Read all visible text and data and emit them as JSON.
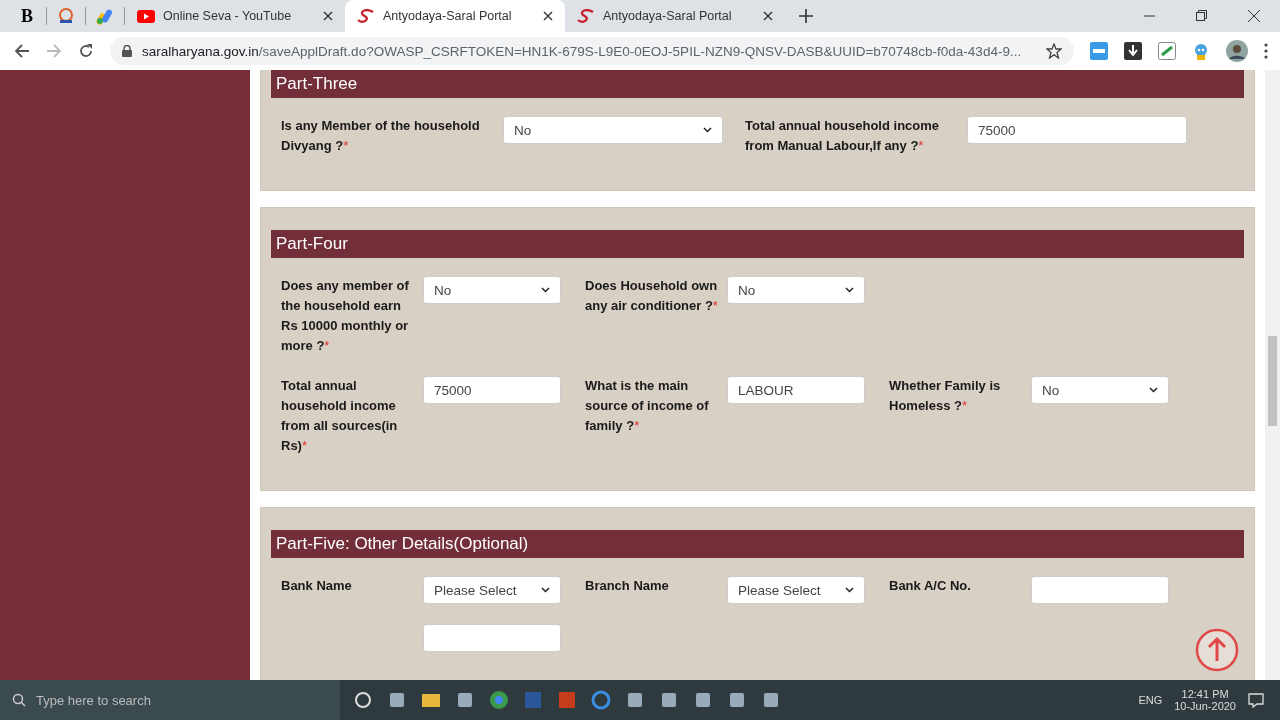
{
  "browser": {
    "pinned_tabs": [
      {
        "kind": "letter",
        "label": "B"
      },
      {
        "kind": "emblem"
      },
      {
        "kind": "ads"
      }
    ],
    "tabs": [
      {
        "title": "Online Seva - YouTube",
        "kind": "youtube",
        "selected": false
      },
      {
        "title": "Antyodaya-Saral Portal",
        "kind": "saral",
        "selected": true
      },
      {
        "title": "Antyodaya-Saral Portal",
        "kind": "saral",
        "selected": false
      }
    ],
    "address": {
      "host": "saralharyana.gov.in",
      "path": "/saveApplDraft.do?OWASP_CSRFTOKEN=HN1K-679S-L9E0-0EOJ-5PIL-NZN9-QNSV-DASB&UUID=b70748cb-f0da-43d4-9..."
    }
  },
  "sections": [
    {
      "title": "Part-Three",
      "kind": "wide",
      "rows": [
        [
          {
            "label": "Is any Member of the household Divyang ?",
            "required_mark": "*",
            "control": {
              "kind": "select",
              "value": "No"
            }
          },
          {
            "label": "Total annual household income from Manual Labour,If any ?",
            "required_mark": "*",
            "control": {
              "kind": "input",
              "value": "75000"
            }
          }
        ]
      ]
    },
    {
      "title": "Part-Four",
      "kind": "narrow",
      "rows": [
        [
          {
            "label": "Does any member of the household earn Rs 10000 monthly or more ?",
            "required_mark": "*",
            "control": {
              "kind": "select",
              "value": "No"
            }
          },
          {
            "label": "Does Household own any air conditioner ?",
            "required_mark": "*",
            "control": {
              "kind": "select",
              "value": "No"
            }
          }
        ],
        [
          {
            "label": "Total annual household income from all sources(in Rs)",
            "required_mark": "*",
            "control": {
              "kind": "input",
              "value": "75000"
            }
          },
          {
            "label": "What is the main source of income of family ?",
            "required_mark": "*",
            "control": {
              "kind": "input",
              "value": "LABOUR"
            }
          },
          {
            "label": "Whether Family is Homeless ?",
            "required_mark": "*",
            "control": {
              "kind": "select",
              "value": "No"
            }
          }
        ]
      ]
    },
    {
      "title": "Part-Five: Other Details(Optional)",
      "kind": "narrow",
      "rows": [
        [
          {
            "label": "Bank Name",
            "control": {
              "kind": "select",
              "value": "Please Select"
            }
          },
          {
            "label": "Branch Name",
            "control": {
              "kind": "select",
              "value": "Please Select"
            }
          },
          {
            "label": "Bank A/C No.",
            "control": {
              "kind": "input"
            }
          }
        ],
        [
          {
            "control": {
              "kind": "input"
            }
          }
        ]
      ]
    }
  ],
  "taskbar": {
    "search": {
      "placeholder": "Type here to search"
    },
    "language": "ENG",
    "time": "12:41 PM",
    "date": "10-Jun-2020"
  }
}
